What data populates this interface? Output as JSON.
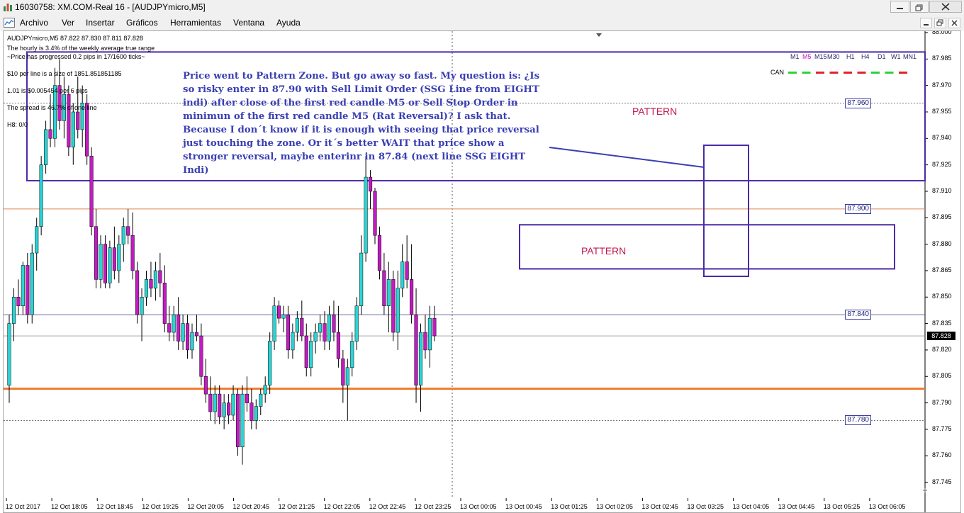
{
  "window": {
    "title": "16030758: XM.COM-Real 16 - [AUDJPYmicro,M5]"
  },
  "menu": {
    "items": [
      "Archivo",
      "Ver",
      "Insertar",
      "Gráficos",
      "Herramientas",
      "Ventana",
      "Ayuda"
    ]
  },
  "info_panel": {
    "symbol_line": "AUDJPYmicro,M5  87.822 87.830 87.811 87.828",
    "hourly": "The hourly is 3.4% of the weekly average true range",
    "progress": "~Price has progressed  0.2  pips in 17/1600 ticks~",
    "per_line": "$10 per line is a size of 1851.851851185",
    "lot": "1.01 is $0.005454 per 6 pips",
    "spread": "The spread is 46.7% of one line",
    "h8": "H8: 0/0"
  },
  "timeframes": [
    "M1",
    "M5",
    "M15",
    "M30",
    "H1",
    "H4",
    "D1",
    "W1",
    "MN1"
  ],
  "active_timeframe": "M5",
  "currency_label": "CAN",
  "annotation_text": "Price went to Pattern Zone. But go away so fast. My question is: ¿Is so risky enter in 87.90 with Sell Limit Order  (SSG Line from EIGHT indi) after close of the first red candle M5 or Sell Stop Order in minimun of the first red candle M5 (Rat Reversal)? I ask that. Because I don´t know if it is enough with seeing that price reversal just touching the zone. Or it´s better WAIT that price show a stronger reversal, maybe enterinr in 87.84 (next line SSG EIGHT Indi)",
  "pattern_labels": [
    "PATTERN",
    "PATTERN"
  ],
  "level_badges": [
    "87.960",
    "87.900",
    "87.840",
    "87.780"
  ],
  "current_price": "87.828",
  "colors": {
    "bull": "#2ad4d4",
    "bear": "#c21bc2",
    "zone": "#4b2aa8",
    "orange_line": "#f07a2a",
    "annotation": "#3a3fb3"
  },
  "chart_data": {
    "type": "candlestick",
    "symbol": "AUDJPYmicro",
    "timeframe": "M5",
    "ylim": [
      87.74,
      88.0
    ],
    "y_ticks": [
      "88.000",
      "87.985",
      "87.970",
      "87.955",
      "87.940",
      "87.925",
      "87.910",
      "87.895",
      "87.880",
      "87.865",
      "87.850",
      "87.835",
      "87.820",
      "87.805",
      "87.790",
      "87.775",
      "87.760",
      "87.745"
    ],
    "x_ticks": [
      "12 Oct 2017",
      "12 Oct 18:05",
      "12 Oct 18:45",
      "12 Oct 19:25",
      "12 Oct 20:05",
      "12 Oct 20:45",
      "12 Oct 21:25",
      "12 Oct 22:05",
      "12 Oct 22:45",
      "12 Oct 23:25",
      "13 Oct 00:05",
      "13 Oct 00:45",
      "13 Oct 01:25",
      "13 Oct 02:05",
      "13 Oct 02:45",
      "13 Oct 03:25",
      "13 Oct 04:05",
      "13 Oct 04:45",
      "13 Oct 05:25",
      "13 Oct 06:05"
    ],
    "horizontal_levels": [
      87.96,
      87.9,
      87.84,
      87.828,
      87.798,
      87.78
    ],
    "pattern_zones": [
      {
        "price_high": 87.989,
        "price_low": 87.916
      },
      {
        "price_high": 87.891,
        "price_low": 87.866
      }
    ],
    "candles": [
      [
        87.8,
        87.84,
        87.79,
        87.835
      ],
      [
        87.835,
        87.855,
        87.825,
        87.85
      ],
      [
        87.85,
        87.86,
        87.84,
        87.845
      ],
      [
        87.845,
        87.87,
        87.84,
        87.868
      ],
      [
        87.868,
        87.875,
        87.835,
        87.84
      ],
      [
        87.84,
        87.88,
        87.835,
        87.875
      ],
      [
        87.875,
        87.895,
        87.865,
        87.89
      ],
      [
        87.89,
        87.93,
        87.885,
        87.925
      ],
      [
        87.925,
        87.95,
        87.92,
        87.945
      ],
      [
        87.945,
        87.965,
        87.935,
        87.94
      ],
      [
        87.94,
        87.98,
        87.935,
        87.97
      ],
      [
        87.97,
        87.985,
        87.945,
        87.95
      ],
      [
        87.95,
        87.975,
        87.94,
        87.965
      ],
      [
        87.965,
        87.97,
        87.93,
        87.935
      ],
      [
        87.935,
        87.96,
        87.925,
        87.955
      ],
      [
        87.955,
        87.975,
        87.94,
        87.945
      ],
      [
        87.945,
        87.97,
        87.935,
        87.96
      ],
      [
        87.96,
        87.965,
        87.925,
        87.93
      ],
      [
        87.93,
        87.935,
        87.885,
        87.89
      ],
      [
        87.89,
        87.9,
        87.855,
        87.86
      ],
      [
        87.86,
        87.885,
        87.855,
        87.88
      ],
      [
        87.88,
        87.885,
        87.855,
        87.858
      ],
      [
        87.858,
        87.882,
        87.855,
        87.878
      ],
      [
        87.878,
        87.89,
        87.86,
        87.865
      ],
      [
        87.865,
        87.885,
        87.858,
        87.88
      ],
      [
        87.88,
        87.895,
        87.87,
        87.89
      ],
      [
        87.89,
        87.9,
        87.88,
        87.885
      ],
      [
        87.885,
        87.898,
        87.86,
        87.865
      ],
      [
        87.865,
        87.87,
        87.835,
        87.84
      ],
      [
        87.84,
        87.855,
        87.825,
        87.85
      ],
      [
        87.85,
        87.865,
        87.845,
        87.86
      ],
      [
        87.86,
        87.87,
        87.85,
        87.855
      ],
      [
        87.855,
        87.87,
        87.848,
        87.865
      ],
      [
        87.865,
        87.875,
        87.85,
        87.858
      ],
      [
        87.858,
        87.868,
        87.83,
        87.835
      ],
      [
        87.835,
        87.845,
        87.825,
        87.83
      ],
      [
        87.83,
        87.845,
        87.825,
        87.84
      ],
      [
        87.84,
        87.85,
        87.82,
        87.825
      ],
      [
        87.825,
        87.84,
        87.82,
        87.835
      ],
      [
        87.835,
        87.84,
        87.815,
        87.82
      ],
      [
        87.82,
        87.835,
        87.815,
        87.83
      ],
      [
        87.83,
        87.84,
        87.825,
        87.828
      ],
      [
        87.828,
        87.835,
        87.8,
        87.805
      ],
      [
        87.805,
        87.815,
        87.79,
        87.795
      ],
      [
        87.795,
        87.805,
        87.78,
        87.785
      ],
      [
        87.785,
        87.8,
        87.778,
        87.795
      ],
      [
        87.795,
        87.8,
        87.778,
        87.782
      ],
      [
        87.782,
        87.795,
        87.775,
        87.79
      ],
      [
        87.79,
        87.795,
        87.778,
        87.783
      ],
      [
        87.783,
        87.8,
        87.78,
        87.795
      ],
      [
        87.795,
        87.798,
        87.76,
        87.765
      ],
      [
        87.765,
        87.8,
        87.755,
        87.795
      ],
      [
        87.795,
        87.805,
        87.785,
        87.79
      ],
      [
        87.79,
        87.798,
        87.775,
        87.78
      ],
      [
        87.78,
        87.792,
        87.775,
        87.788
      ],
      [
        87.788,
        87.798,
        87.783,
        87.795
      ],
      [
        87.795,
        87.805,
        87.79,
        87.8
      ],
      [
        87.8,
        87.83,
        87.795,
        87.825
      ],
      [
        87.825,
        87.85,
        87.82,
        87.845
      ],
      [
        87.845,
        87.848,
        87.835,
        87.838
      ],
      [
        87.838,
        87.845,
        87.83,
        87.84
      ],
      [
        87.84,
        87.845,
        87.815,
        87.82
      ],
      [
        87.82,
        87.835,
        87.815,
        87.83
      ],
      [
        87.83,
        87.842,
        87.825,
        87.838
      ],
      [
        87.838,
        87.848,
        87.825,
        87.828
      ],
      [
        87.828,
        87.835,
        87.805,
        87.81
      ],
      [
        87.81,
        87.83,
        87.805,
        87.825
      ],
      [
        87.825,
        87.835,
        87.818,
        87.83
      ],
      [
        87.83,
        87.84,
        87.825,
        87.835
      ],
      [
        87.835,
        87.842,
        87.82,
        87.825
      ],
      [
        87.825,
        87.845,
        87.82,
        87.84
      ],
      [
        87.84,
        87.848,
        87.825,
        87.83
      ],
      [
        87.83,
        87.845,
        87.81,
        87.815
      ],
      [
        87.815,
        87.82,
        87.79,
        87.8
      ],
      [
        87.8,
        87.815,
        87.78,
        87.81
      ],
      [
        87.81,
        87.83,
        87.805,
        87.825
      ],
      [
        87.825,
        87.85,
        87.82,
        87.845
      ],
      [
        87.845,
        87.885,
        87.84,
        87.875
      ],
      [
        87.875,
        87.93,
        87.87,
        87.918
      ],
      [
        87.918,
        87.922,
        87.9,
        87.91
      ],
      [
        87.91,
        87.912,
        87.88,
        87.885
      ],
      [
        87.885,
        87.89,
        87.86,
        87.865
      ],
      [
        87.865,
        87.875,
        87.84,
        87.845
      ],
      [
        87.845,
        87.87,
        87.83,
        87.86
      ],
      [
        87.86,
        87.865,
        87.825,
        87.83
      ],
      [
        87.83,
        87.865,
        87.82,
        87.855
      ],
      [
        87.855,
        87.88,
        87.85,
        87.87
      ],
      [
        87.87,
        87.885,
        87.855,
        87.86
      ],
      [
        87.86,
        87.88,
        87.835,
        87.84
      ],
      [
        87.84,
        87.855,
        87.79,
        87.8
      ],
      [
        87.8,
        87.835,
        87.785,
        87.83
      ],
      [
        87.83,
        87.84,
        87.815,
        87.82
      ],
      [
        87.82,
        87.845,
        87.81,
        87.838
      ],
      [
        87.838,
        87.845,
        87.825,
        87.828
      ]
    ]
  }
}
